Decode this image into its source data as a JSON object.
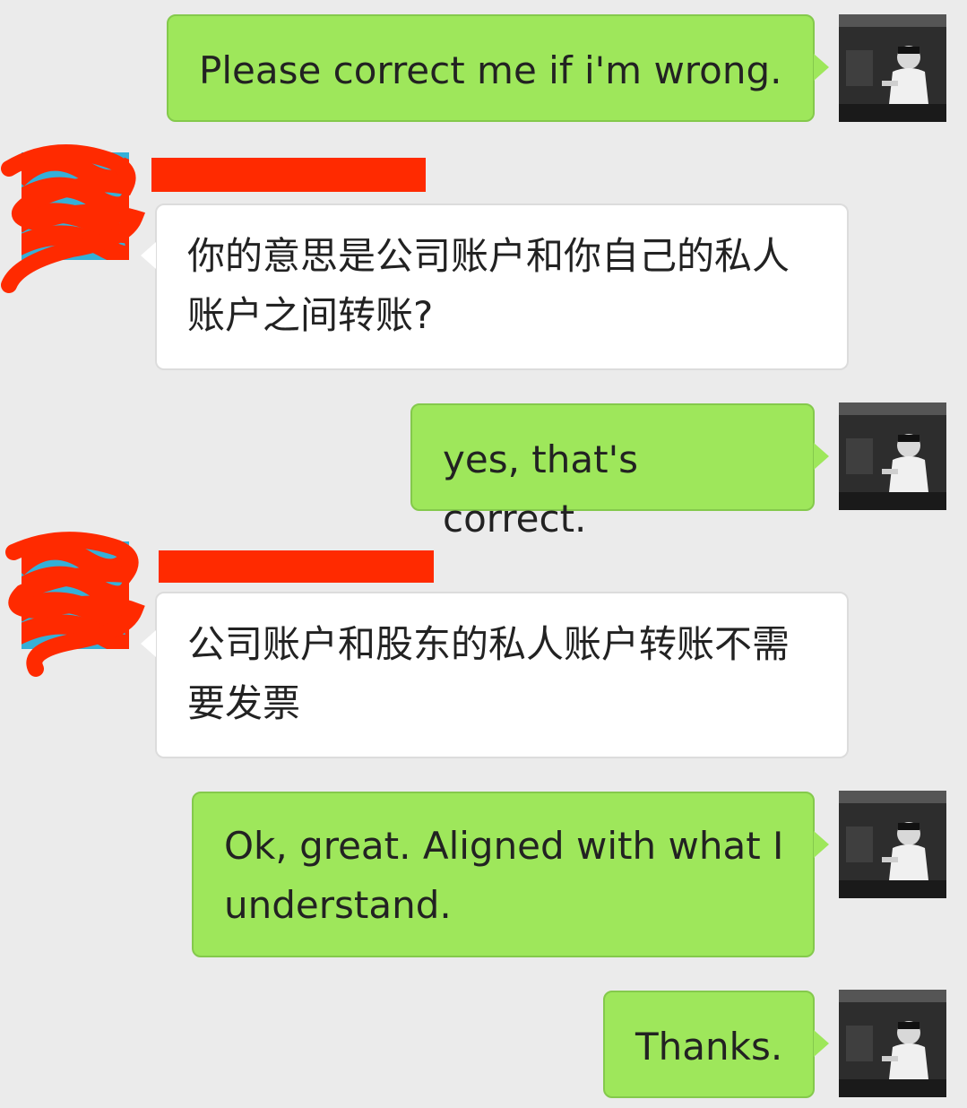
{
  "colors": {
    "background": "#ebebeb",
    "outgoing_bubble": "#9ee75b",
    "incoming_bubble": "#ffffff",
    "redaction": "#ff2a00",
    "text": "#222222"
  },
  "messages": [
    {
      "direction": "outgoing",
      "text": "Please correct me if i'm wrong."
    },
    {
      "direction": "incoming",
      "sender_redacted": true,
      "text": "你的意思是公司账户和你自己的私人账户之间转账?"
    },
    {
      "direction": "outgoing",
      "text": "yes, that's correct."
    },
    {
      "direction": "incoming",
      "sender_redacted": true,
      "text": "公司账户和股东的私人账户转账不需要发票"
    },
    {
      "direction": "outgoing",
      "text": "Ok, great. Aligned with what I understand."
    },
    {
      "direction": "outgoing",
      "text": "Thanks."
    }
  ],
  "icons": {
    "self_avatar": "user-avatar-photo-icon",
    "contact_avatar": "contact-avatar-redacted-icon"
  }
}
